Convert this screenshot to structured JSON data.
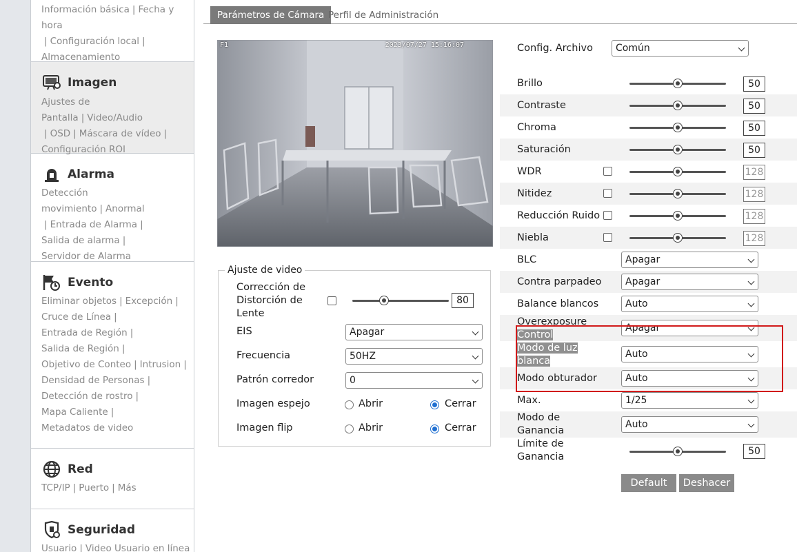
{
  "sidebar": {
    "top_links": [
      "Información básica",
      "Fecha y hora",
      "Configuración local",
      "Almacenamiento"
    ],
    "sections": [
      {
        "title": "Imagen",
        "icon": "image-settings-icon",
        "links": [
          "Ajustes de Pantalla",
          "Video/Audio",
          "OSD",
          "Máscara de vídeo",
          "Configuración ROI"
        ]
      },
      {
        "title": "Alarma",
        "icon": "alarm-icon",
        "links": [
          "Detección movimiento",
          "Anormal",
          "Entrada de Alarma",
          "Salida de alarma",
          "Servidor de Alarma"
        ]
      },
      {
        "title": "Evento",
        "icon": "event-icon",
        "links": [
          "Eliminar objetos",
          "Excepción",
          "Cruce de Línea",
          "Entrada de Región",
          "Salida de Región",
          "Objetivo de Conteo",
          "Intrusion",
          "Densidad de Personas",
          "Detección de rostro",
          "Mapa Caliente",
          "Metadatos de video"
        ]
      },
      {
        "title": "Red",
        "icon": "globe-icon",
        "links": [
          "TCP/IP",
          "Puerto",
          "Más"
        ]
      },
      {
        "title": "Seguridad",
        "icon": "shield-icon",
        "links": [
          "Usuario",
          "Video Usuario en línea"
        ]
      }
    ]
  },
  "tabs": [
    {
      "label": "Parámetros de Cámara",
      "active": true
    },
    {
      "label": "Perfil de Administración",
      "active": false
    }
  ],
  "preview": {
    "osd_left": "F1",
    "osd_right": "2023/07/27 15:16:07"
  },
  "video_adjust": {
    "legend": "Ajuste de video",
    "distortion": {
      "label_lines": [
        "Corrección de",
        "Distorción de",
        "Lente"
      ],
      "checked": false,
      "value": "80",
      "fraction": 0.33
    },
    "eis": {
      "label": "EIS",
      "value": "Apagar"
    },
    "frequency": {
      "label": "Frecuencia",
      "value": "50HZ"
    },
    "corridor": {
      "label": "Patrón corredor",
      "value": "0"
    },
    "mirror": {
      "label": "Imagen espejo",
      "open": "Abrir",
      "close": "Cerrar",
      "selected": "Cerrar"
    },
    "flip": {
      "label": "Imagen flip",
      "open": "Abrir",
      "close": "Cerrar",
      "selected": "Cerrar"
    }
  },
  "config": {
    "profile_label": "Config. Archivo",
    "profile_value": "Común",
    "sliders": [
      {
        "label": "Brillo",
        "value": "50",
        "checkbox": false,
        "disabled": false,
        "fraction": 0.5
      },
      {
        "label": "Contraste",
        "value": "50",
        "checkbox": false,
        "disabled": false,
        "fraction": 0.5
      },
      {
        "label": "Chroma",
        "value": "50",
        "checkbox": false,
        "disabled": false,
        "fraction": 0.5
      },
      {
        "label": "Saturación",
        "value": "50",
        "checkbox": false,
        "disabled": false,
        "fraction": 0.5
      },
      {
        "label": "WDR",
        "value": "128",
        "checkbox": true,
        "disabled": true,
        "fraction": 0.5
      },
      {
        "label": "Nitidez",
        "value": "128",
        "checkbox": true,
        "disabled": true,
        "fraction": 0.5
      },
      {
        "label": "Reducción Ruido",
        "value": "128",
        "checkbox": true,
        "disabled": true,
        "fraction": 0.5
      },
      {
        "label": "Niebla",
        "value": "128",
        "checkbox": true,
        "disabled": true,
        "fraction": 0.5
      }
    ],
    "selects": [
      {
        "label": "BLC",
        "value": "Apagar"
      },
      {
        "label": "Contra parpadeo",
        "value": "Apagar"
      },
      {
        "label": "Balance blancos",
        "value": "Auto"
      }
    ],
    "overexposure": {
      "label_lines": [
        "Overexposure",
        "Control"
      ],
      "value": "Apagar"
    },
    "white_light": {
      "label_lines": [
        "Modo de luz",
        "blanca"
      ],
      "value": "Auto"
    },
    "shutter": {
      "label": "Modo obturador",
      "value": "Auto"
    },
    "max": {
      "label": "Max.",
      "value": "1/25"
    },
    "gain_mode": {
      "label_lines": [
        "Modo de",
        "Ganancia"
      ],
      "value": "Auto"
    },
    "gain_limit": {
      "label_lines": [
        "Límite de",
        "Ganancia"
      ],
      "value": "50",
      "fraction": 0.5
    },
    "buttons": {
      "default": "Default",
      "undo": "Deshacer"
    }
  }
}
